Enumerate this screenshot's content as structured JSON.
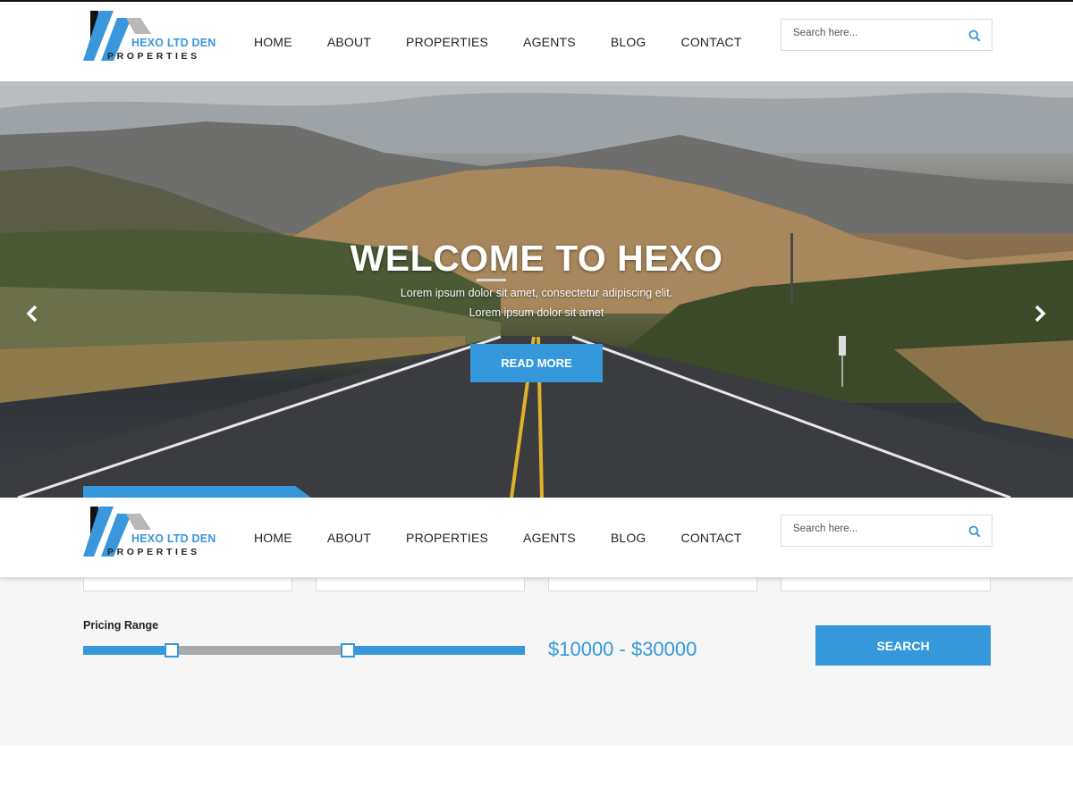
{
  "brand": {
    "name": "HEXO LTD DEN",
    "tagline": "PROPERTIES"
  },
  "nav": {
    "items": [
      "HOME",
      "ABOUT",
      "PROPERTIES",
      "AGENTS",
      "BLOG",
      "CONTACT"
    ]
  },
  "search": {
    "placeholder": "Search here..."
  },
  "hero": {
    "title": "WELCOME TO HEXO",
    "line1": "Lorem ipsum dolor sit amet, consectetur adipiscing elit.",
    "line2": "Lorem ipsum dolor sit amet",
    "button_label": "READ MORE",
    "prev_icon": "chevron-left-icon",
    "next_icon": "chevron-right-icon"
  },
  "filters": {
    "pricing_label": "Pricing Range",
    "price_range_text": "$10000 - $30000",
    "range_start_fraction": 0.2,
    "range_end_fraction": 0.6,
    "search_button_label": "SEARCH"
  },
  "colors": {
    "accent": "#3498db",
    "text": "#222222",
    "filter_bg": "#f6f6f6"
  }
}
